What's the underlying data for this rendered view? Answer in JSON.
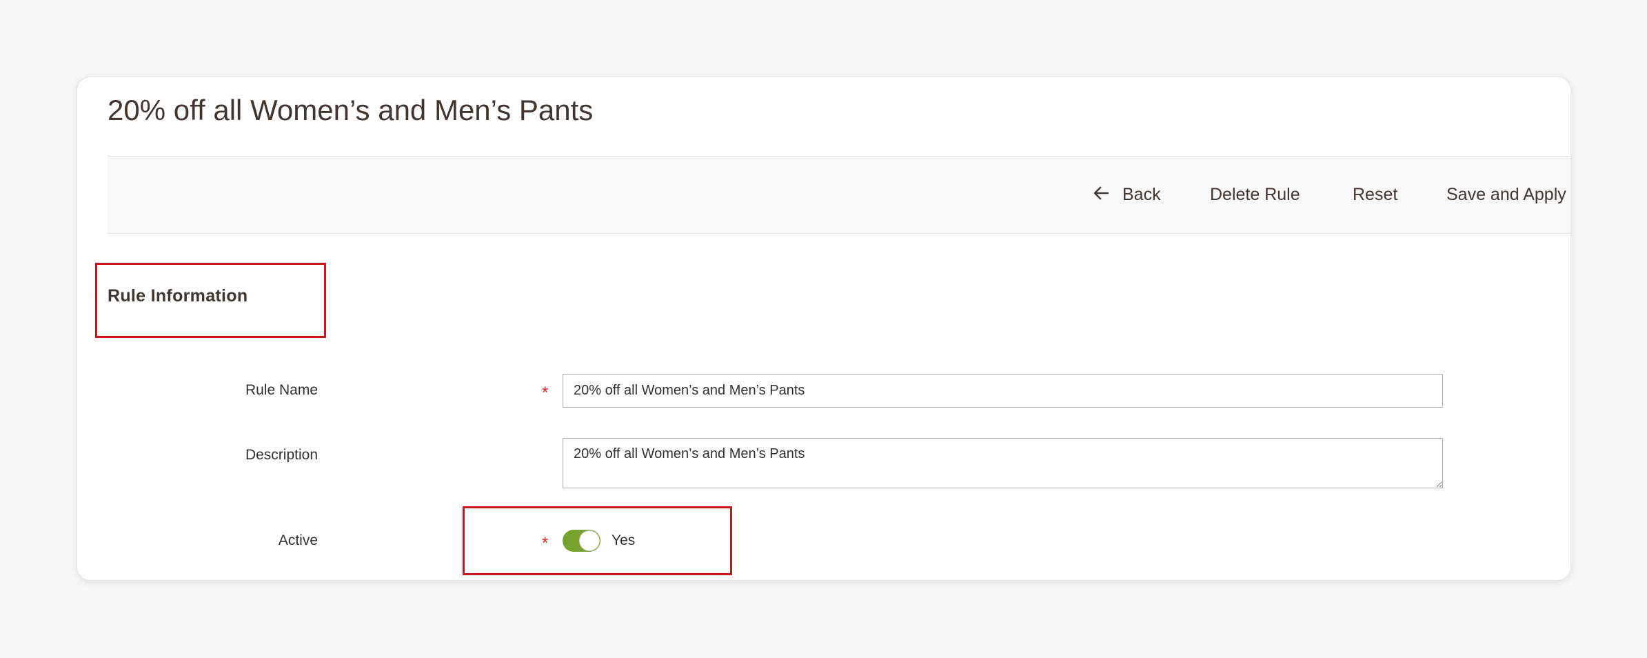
{
  "page": {
    "title": "20% off all Women’s and Men’s Pants"
  },
  "actions": {
    "back_label": "Back",
    "delete_label": "Delete Rule",
    "reset_label": "Reset",
    "save_label": "Save and Apply"
  },
  "section": {
    "title": "Rule Information"
  },
  "form": {
    "rule_name": {
      "label": "Rule Name",
      "required_mark": "*",
      "value": "20% off all Women’s and Men’s Pants"
    },
    "description": {
      "label": "Description",
      "value": "20% off all Women’s and Men’s Pants"
    },
    "active": {
      "label": "Active",
      "required_mark": "*",
      "state": true,
      "state_label": "Yes"
    }
  },
  "colors": {
    "toggle_on": "#79a22e",
    "highlight": "#c8171c",
    "required": "#e22626",
    "title_text": "#41362f"
  },
  "icons": {
    "back": "arrow-left-icon"
  }
}
